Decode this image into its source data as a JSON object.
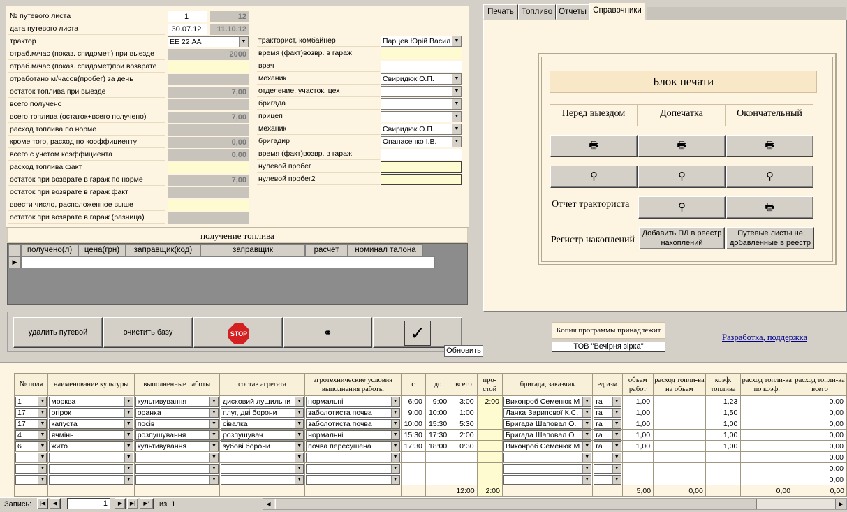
{
  "header": {
    "rows": [
      {
        "label": "№ путевого листа",
        "v1": "1",
        "v2": "12"
      },
      {
        "label": "дата путевого листа",
        "v1": "30.07.12",
        "v2": "11.10.12"
      },
      {
        "label": "трактор",
        "v1": "ЕЕ 22 АА",
        "v2": ""
      },
      {
        "label": "отраб.м/час (показ. спидомет.) при выезде",
        "v1": "",
        "v2": "2000"
      },
      {
        "label": "отраб.м/час (показ. спидомет)при возврате",
        "v1": "",
        "v2": ""
      },
      {
        "label": "отработано м/часов(пробег) за день",
        "v1": "",
        "v2": ""
      },
      {
        "label": "остаток топлива при выезде",
        "v1": "",
        "v2": "7,00"
      },
      {
        "label": "всего получено",
        "v1": "",
        "v2": ""
      },
      {
        "label": "всего топлива (остаток+всего получено)",
        "v1": "",
        "v2": "7,00"
      },
      {
        "label": "расход топлива по норме",
        "v1": "",
        "v2": ""
      },
      {
        "label": "кроме того, расход по коэффициенту",
        "v1": "",
        "v2": "0,00"
      },
      {
        "label": "всего с учетом коэффициента",
        "v1": "",
        "v2": "0,00"
      },
      {
        "label": "расход топлива факт",
        "v1": "",
        "v2": ""
      },
      {
        "label": "остаток при возврате в гараж по норме",
        "v1": "",
        "v2": "7,00"
      },
      {
        "label": "остаток при возврате в гараж  факт",
        "v1": "",
        "v2": ""
      },
      {
        "label": "ввести число, расположенное выше",
        "v1": "",
        "v2": ""
      },
      {
        "label": "остаток при возврате в гараж (разница)",
        "v1": "",
        "v2": ""
      }
    ]
  },
  "staff": [
    {
      "label": "тракторист, комбайнер",
      "value": "Парцев Юрій Васил"
    },
    {
      "label": "время (факт)возвр. в гараж",
      "value": ""
    },
    {
      "label": "врач",
      "value": ""
    },
    {
      "label": "механик",
      "value": "Свиридюк О.П."
    },
    {
      "label": "отделение, участок, цех",
      "value": ""
    },
    {
      "label": "бригада",
      "value": ""
    },
    {
      "label": "прицеп",
      "value": ""
    },
    {
      "label": "механик",
      "value": "Свиридюк О.П."
    },
    {
      "label": "бригадир",
      "value": "Опанасенко І.В."
    },
    {
      "label": "время (факт)возвр. в гараж",
      "value": ""
    },
    {
      "label": "нулевой пробег",
      "value": ""
    },
    {
      "label": "нулевой пробег2",
      "value": ""
    }
  ],
  "fuel": {
    "title": "получение топлива",
    "cols": [
      "получено(л)",
      "цена(грн)",
      "заправщик(код)",
      "заправщик",
      "расчет",
      "номинал талона"
    ]
  },
  "actions": {
    "delete": "удалить путевой",
    "clear": "очистить базу",
    "stop": "STOP",
    "update_tip": "Обновить"
  },
  "tabs": [
    "Печать",
    "Топливо",
    "Отчеты",
    "Справочники"
  ],
  "print": {
    "title": "Блок печати",
    "cols": [
      "Перед выездом",
      "Допечатка",
      "Окончательный"
    ],
    "report": "Отчет тракториста",
    "registry": "Регистр накоплений",
    "add_btn": "Добавить ПЛ в реестр накоплений",
    "notadded_btn": "Путевые листы не добавленные в реестр"
  },
  "copy": {
    "label": "Копия программы принадлежит",
    "owner": "ТОВ \"Вечірня зірка\"",
    "support": "Разработка, поддержка"
  },
  "works": {
    "cols": [
      "№ поля",
      "наименование культуры",
      "выполненные работы",
      "состав агрегата",
      "агротехнические условия выполнения работы",
      "с",
      "до",
      "всего",
      "про-стой",
      "бригада, заказчик",
      "ед изм",
      "объем работ",
      "расход топли-ва на объем",
      "коэф. топлива",
      "расход топли-ва по коэф.",
      "расход топли-ва всего"
    ],
    "rows": [
      [
        "1",
        "морква",
        "культивування",
        "дисковий лущильни",
        "нормальні",
        "6:00",
        "9:00",
        "3:00",
        "2:00",
        "Виконроб Семенюк М",
        "га",
        "1,00",
        "",
        "1,23",
        "",
        "0,00"
      ],
      [
        "17",
        "огірок",
        "оранка",
        "плуг, дві борони",
        "заболотиста почва",
        "9:00",
        "10:00",
        "1:00",
        "",
        "Ланка Зарипової К.С.",
        "га",
        "1,00",
        "",
        "1,50",
        "",
        "0,00"
      ],
      [
        "17",
        "капуста",
        "посів",
        "сівалка",
        "заболотиста почва",
        "10:00",
        "15:30",
        "5:30",
        "",
        "Бригада Шаповал О.",
        "га",
        "1,00",
        "",
        "1,00",
        "",
        "0,00"
      ],
      [
        "4",
        "ячмінь",
        "розпушування",
        "розпушувач",
        "нормальні",
        "15:30",
        "17:30",
        "2:00",
        "",
        "Бригада Шаповал О.",
        "га",
        "1,00",
        "",
        "1,00",
        "",
        "0,00"
      ],
      [
        "6",
        "жито",
        "культивування",
        "зубові борони",
        "почва пересушена",
        "17:30",
        "18:00",
        "0:30",
        "",
        "Виконроб Семенюк М",
        "га",
        "1,00",
        "",
        "1,00",
        "",
        "0,00"
      ],
      [
        "",
        "",
        "",
        "",
        "",
        "",
        "",
        "",
        "",
        "",
        "",
        "",
        "",
        "",
        "",
        "0,00"
      ],
      [
        "",
        "",
        "",
        "",
        "",
        "",
        "",
        "",
        "",
        "",
        "",
        "",
        "",
        "",
        "",
        "0,00"
      ],
      [
        "",
        "",
        "",
        "",
        "",
        "",
        "",
        "",
        "",
        "",
        "",
        "",
        "",
        "",
        "",
        "0,00"
      ]
    ],
    "totals": {
      "vsego": "12:00",
      "prostoy": "2:00",
      "obem": "5,00",
      "rashod_obem": "0,00",
      "rashod_koef": "0,00",
      "rashod_vsego": "0,00"
    }
  },
  "nav": {
    "label": "Запись:",
    "current": "1",
    "of": "из  1"
  }
}
